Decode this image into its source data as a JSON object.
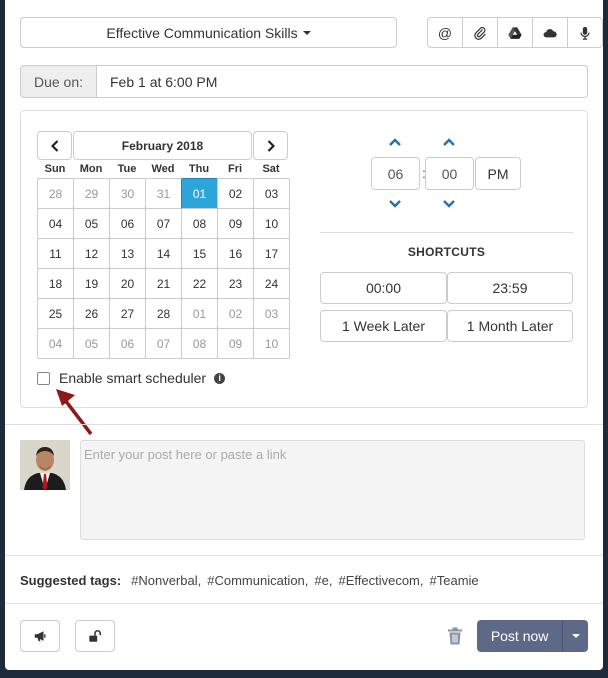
{
  "group_select": {
    "label": "Effective Communication Skills"
  },
  "toolbar_icons": [
    "at-icon",
    "paperclip-icon",
    "google-drive-icon",
    "onedrive-icon",
    "microphone-icon"
  ],
  "due": {
    "label": "Due on:",
    "value": "Feb 1 at 6:00 PM"
  },
  "calendar": {
    "title": "February 2018",
    "weekdays": [
      "Sun",
      "Mon",
      "Tue",
      "Wed",
      "Thu",
      "Fri",
      "Sat"
    ],
    "days": [
      {
        "d": "28",
        "m": true
      },
      {
        "d": "29",
        "m": true
      },
      {
        "d": "30",
        "m": true
      },
      {
        "d": "31",
        "m": true
      },
      {
        "d": "01",
        "sel": true
      },
      {
        "d": "02"
      },
      {
        "d": "03"
      },
      {
        "d": "04"
      },
      {
        "d": "05"
      },
      {
        "d": "06"
      },
      {
        "d": "07"
      },
      {
        "d": "08"
      },
      {
        "d": "09"
      },
      {
        "d": "10"
      },
      {
        "d": "11"
      },
      {
        "d": "12"
      },
      {
        "d": "13"
      },
      {
        "d": "14"
      },
      {
        "d": "15"
      },
      {
        "d": "16"
      },
      {
        "d": "17"
      },
      {
        "d": "18"
      },
      {
        "d": "19"
      },
      {
        "d": "20"
      },
      {
        "d": "21"
      },
      {
        "d": "22"
      },
      {
        "d": "23"
      },
      {
        "d": "24"
      },
      {
        "d": "25"
      },
      {
        "d": "26"
      },
      {
        "d": "27"
      },
      {
        "d": "28"
      },
      {
        "d": "01",
        "m": true
      },
      {
        "d": "02",
        "m": true
      },
      {
        "d": "03",
        "m": true
      },
      {
        "d": "04",
        "m": true
      },
      {
        "d": "05",
        "m": true
      },
      {
        "d": "06",
        "m": true
      },
      {
        "d": "07",
        "m": true
      },
      {
        "d": "08",
        "m": true
      },
      {
        "d": "09",
        "m": true
      },
      {
        "d": "10",
        "m": true
      }
    ]
  },
  "smart_scheduler": {
    "label": "Enable smart scheduler",
    "checked": false
  },
  "time": {
    "hour": "06",
    "separator": ":",
    "minute": "00",
    "ampm": "PM"
  },
  "shortcuts": {
    "title": "SHORTCUTS",
    "buttons": [
      "00:00",
      "23:59",
      "1 Week Later",
      "1 Month Later"
    ]
  },
  "post": {
    "placeholder": "Enter your post here or paste a link"
  },
  "suggested_tags": {
    "label": "Suggested tags:",
    "tags": [
      "#Nonverbal,",
      "#Communication,",
      "#e,",
      "#Effectivecom,",
      "#Teamie"
    ]
  },
  "footer": {
    "post_button": "Post now"
  },
  "colors": {
    "selected_day": "#2ea5d8",
    "post_button": "#5e6987",
    "arrow_annotation": "#8b1a1a",
    "time_arrows": "#2a6fa8"
  }
}
